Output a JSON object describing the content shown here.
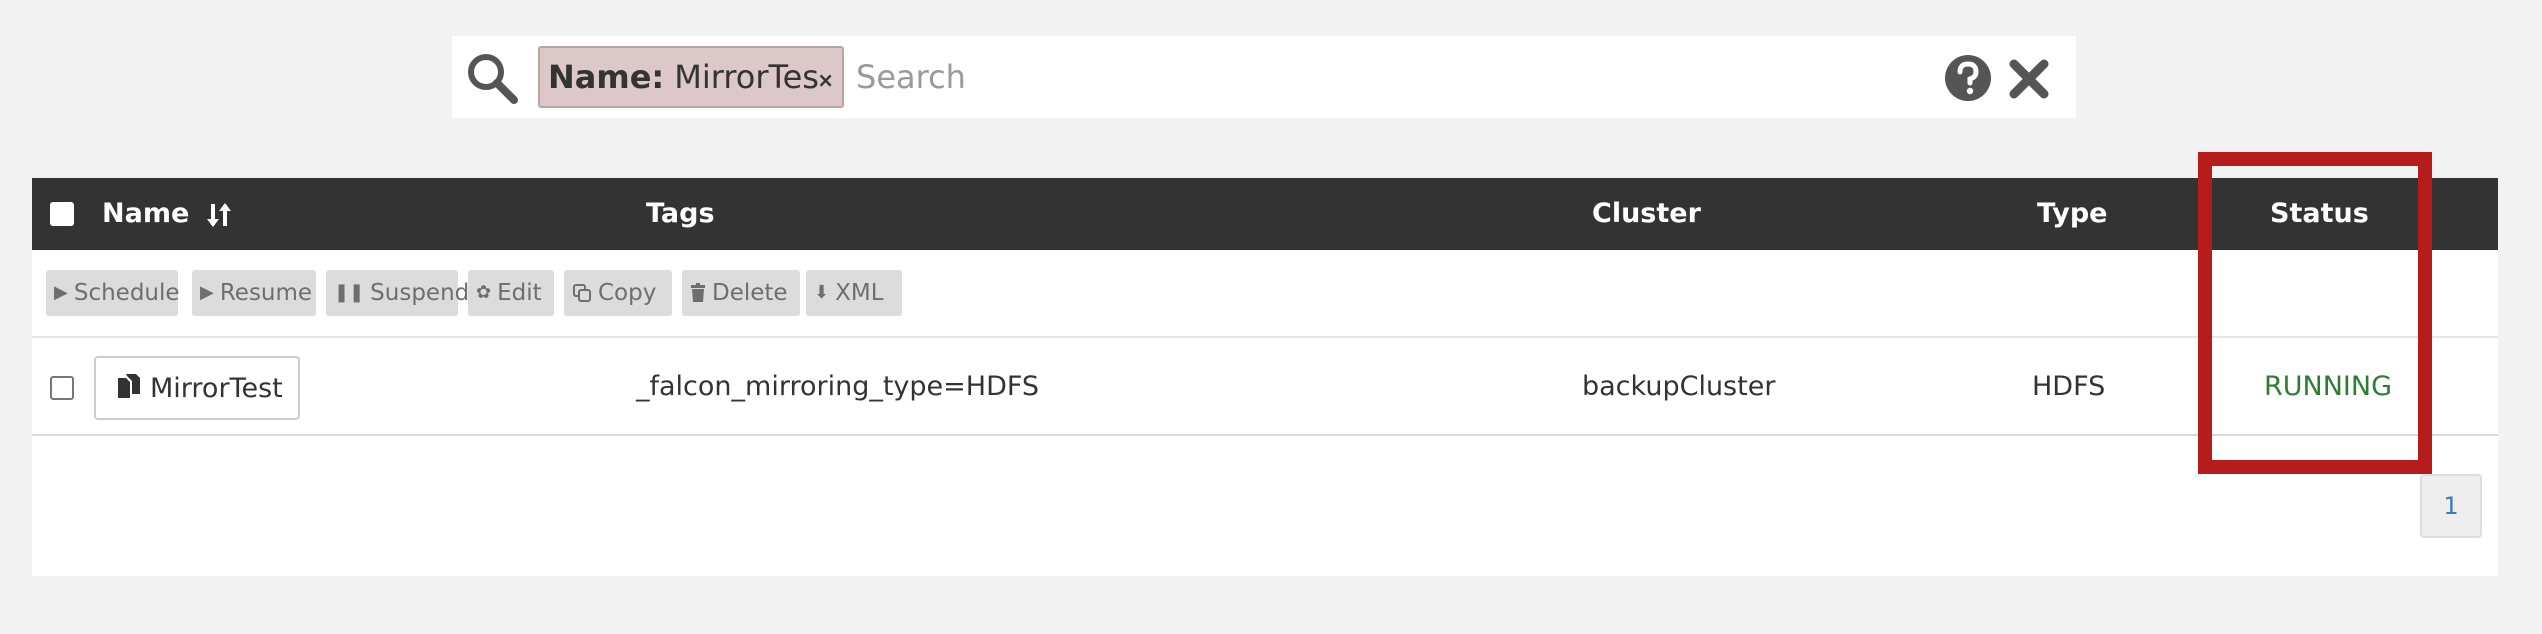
{
  "search": {
    "filter_key": "Name:",
    "filter_value": "MirrorTes",
    "filter_remove": "×",
    "placeholder": "Search"
  },
  "table": {
    "headers": {
      "name": "Name",
      "tags": "Tags",
      "cluster": "Cluster",
      "type": "Type",
      "status": "Status"
    },
    "toolbar": {
      "schedule": "Schedule",
      "resume": "Resume",
      "suspend": "Suspend",
      "edit": "Edit",
      "copy": "Copy",
      "delete": "Delete",
      "xml": "XML"
    },
    "rows": [
      {
        "name": "MirrorTest",
        "tags": "_falcon_mirroring_type=HDFS",
        "cluster": "backupCluster",
        "type": "HDFS",
        "status": "RUNNING"
      }
    ]
  },
  "pagination": {
    "current_page": "1"
  },
  "colors": {
    "header_bg": "#333333",
    "status_running": "#2e7d32",
    "highlight": "#b71c1c",
    "page_link": "#3a7cc0"
  },
  "icons": {
    "search": "search-icon",
    "help": "help-icon",
    "clear": "clear-icon",
    "sort": "sort-icon",
    "file": "file-icon"
  }
}
